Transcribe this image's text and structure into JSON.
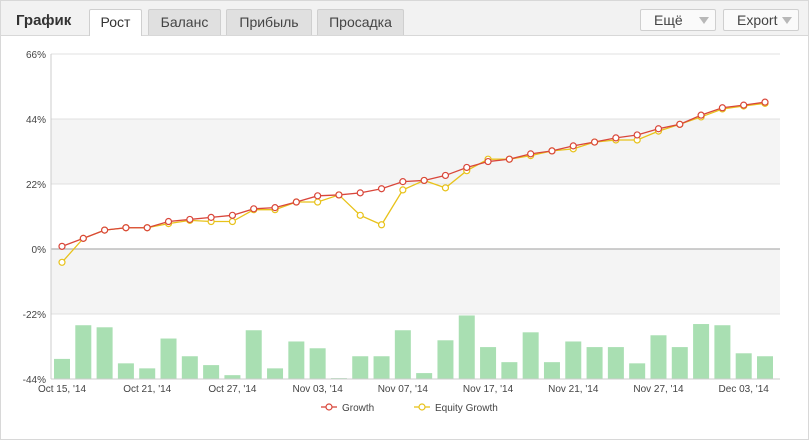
{
  "header": {
    "title": "График",
    "tabs": [
      {
        "label": "Рост",
        "active": true
      },
      {
        "label": "Баланс",
        "active": false
      },
      {
        "label": "Прибыль",
        "active": false
      },
      {
        "label": "Просадка",
        "active": false
      }
    ],
    "more_label": "Ещё",
    "export_label": "Export"
  },
  "colors": {
    "growth": "#d9463a",
    "equity": "#e8c21a",
    "bars": "#a9dfb2",
    "band": "#f4f4f4",
    "grid": "#e0e0e0",
    "zero_line": "#bdbdbd"
  },
  "chart_data": {
    "type": "line",
    "y_tick_labels": [
      "66%",
      "44%",
      "22%",
      "0%",
      "-22%",
      "-44%"
    ],
    "ylim": [
      -44,
      66
    ],
    "x_tick_labels": [
      "Oct 15, '14",
      "Oct 21, '14",
      "Oct 27, '14",
      "Nov 03, '14",
      "Nov 07, '14",
      "Nov 17, '14",
      "Nov 21, '14",
      "Nov 27, '14",
      "Dec 03, '14"
    ],
    "x_tick_indices": [
      0,
      4,
      8,
      12,
      16,
      20,
      24,
      28,
      32
    ],
    "legend_position": "bottom-center",
    "grid": true,
    "series": [
      {
        "name": "Growth",
        "values": [
          0.9,
          3.6,
          6.4,
          7.2,
          7.2,
          9.3,
          10.0,
          10.7,
          11.4,
          13.6,
          14.0,
          15.9,
          18.0,
          18.3,
          19.0,
          20.4,
          22.8,
          23.2,
          24.9,
          27.6,
          29.6,
          30.4,
          32.2,
          33.2,
          34.9,
          36.2,
          37.6,
          38.6,
          40.7,
          42.2,
          45.3,
          47.8,
          48.7,
          49.7
        ]
      },
      {
        "name": "Equity Growth",
        "values": [
          -4.5,
          3.6,
          6.4,
          7.2,
          7.2,
          8.6,
          9.7,
          9.3,
          9.3,
          13.3,
          13.3,
          15.9,
          15.9,
          18.3,
          11.4,
          8.2,
          20.0,
          23.2,
          20.7,
          26.5,
          30.4,
          30.4,
          31.6,
          33.2,
          33.9,
          36.2,
          36.9,
          36.9,
          39.9,
          42.2,
          44.7,
          47.4,
          48.4,
          49.3
        ]
      },
      {
        "name": "",
        "kind": "bars",
        "values": [
          -37.2,
          -25.8,
          -26.5,
          -38.7,
          -40.4,
          -30.3,
          -36.3,
          -39.3,
          -42.7,
          -27.5,
          -40.4,
          -31.3,
          -33.6,
          -43.7,
          -36.3,
          -36.3,
          -27.5,
          -42.0,
          -30.9,
          -22.5,
          -33.2,
          -38.3,
          -28.2,
          -38.3,
          -31.3,
          -33.2,
          -33.2,
          -38.7,
          -29.2,
          -33.2,
          -25.4,
          -25.8,
          -35.3,
          -36.3
        ]
      }
    ]
  }
}
